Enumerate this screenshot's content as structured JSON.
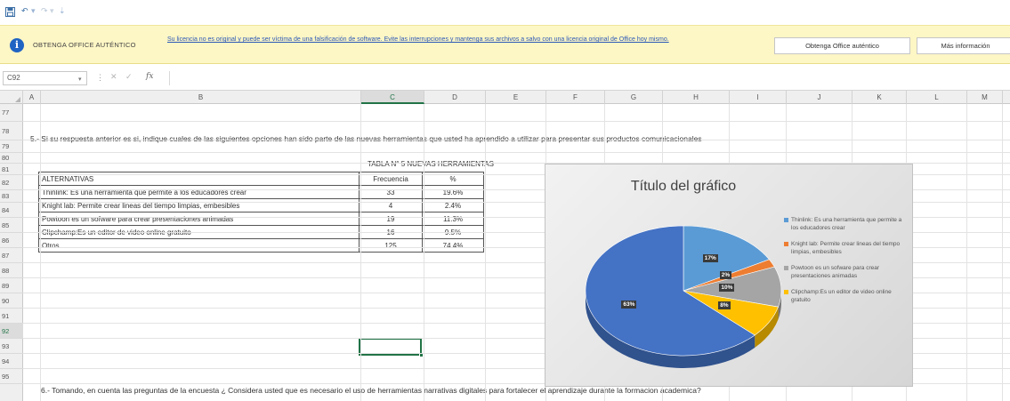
{
  "quick_access": {
    "save_icon": "save-icon",
    "undo_icon": "undo-icon",
    "redo_icon": "redo-icon",
    "customize_icon": "customize-icon"
  },
  "license_bar": {
    "icon": "info-icon",
    "title": "OBTENGA OFFICE AUTÉNTICO",
    "message": "Su licencia no es original y puede ser víctima de una falsificación de software. Evite las interrupciones y mantenga sus archivos a salvo con una licencia original de Office hoy mismo.",
    "primary_button": "Obtenga Office auténtico",
    "secondary_button": "Más información"
  },
  "formula_bar": {
    "name_box": "C92",
    "fx_label": "fx",
    "value": ""
  },
  "columns": [
    "A",
    "B",
    "C",
    "D",
    "E",
    "F",
    "G",
    "H",
    "I",
    "J",
    "K",
    "L",
    "M"
  ],
  "active_column": "C",
  "rows": [
    "77",
    "78",
    "79",
    "80",
    "81",
    "82",
    "83",
    "84",
    "85",
    "86",
    "87",
    "88",
    "89",
    "90",
    "91",
    "92",
    "93",
    "94",
    "95"
  ],
  "active_row": "92",
  "sheet": {
    "question_5": "5.- Si su respuesta anterior es si, indique cuales de las siguientes opciones han sido parte de las nuevas herramientas que usted ha aprendido a utilizar para presentar sus productos comunicacionales",
    "table_caption": "TABLA N° 5 NUEVAS HERRAMIENTAS",
    "question_6": "6.- Tomando, en cuenta las preguntas de la encuesta ¿ Considera usted que es necesario el uso de herramientas narrativas digitales para fortalecer el aprendizaje durante la formacion academica?"
  },
  "table": {
    "headers": [
      "ALTERNATIVAS",
      "Frecuencia",
      "%"
    ],
    "rows": [
      [
        "Thinlink: Es una herramienta que permite a los educadores crear",
        "33",
        "19.6%"
      ],
      [
        "Knight lab: Permite crear lineas del tiempo limpias, embesibles",
        "4",
        "2.4%"
      ],
      [
        "Powtoon es un sofware para crear presentaciones  animadas",
        "19",
        "11.3%"
      ],
      [
        "Clipchamp:Es un editor de video online gratuito",
        "16",
        "9.5%"
      ],
      [
        "Otros",
        "125",
        "74.4%"
      ]
    ]
  },
  "chart_data": {
    "type": "pie",
    "title": "Título del gráfico",
    "categories": [
      "Thinlink: Es una herramienta que permite a los educadores crear",
      "Knight lab: Permite crear lineas del tiempo limpias, embesibles",
      "Powtoon es un sofware para crear presentaciones animadas",
      "Clipchamp:Es un editor de video online gratuito",
      "Otros"
    ],
    "values": [
      17,
      2,
      10,
      8,
      63
    ],
    "data_labels": [
      "17%",
      "2%",
      "10%",
      "8%",
      "63%"
    ],
    "colors": [
      "#5b9bd5",
      "#ed7d31",
      "#a5a5a5",
      "#ffc000",
      "#4472c4"
    ],
    "legend_entries": [
      "Thinlink: Es una herramienta que permite a los educadores crear",
      "Knight lab: Permite crear lineas del tiempo limpias, embesibles",
      "Powtoon es un sofware para crear presentaciones animadas",
      "Clipchamp:Es un editor de video online gratuito"
    ],
    "legend_position": "right"
  }
}
